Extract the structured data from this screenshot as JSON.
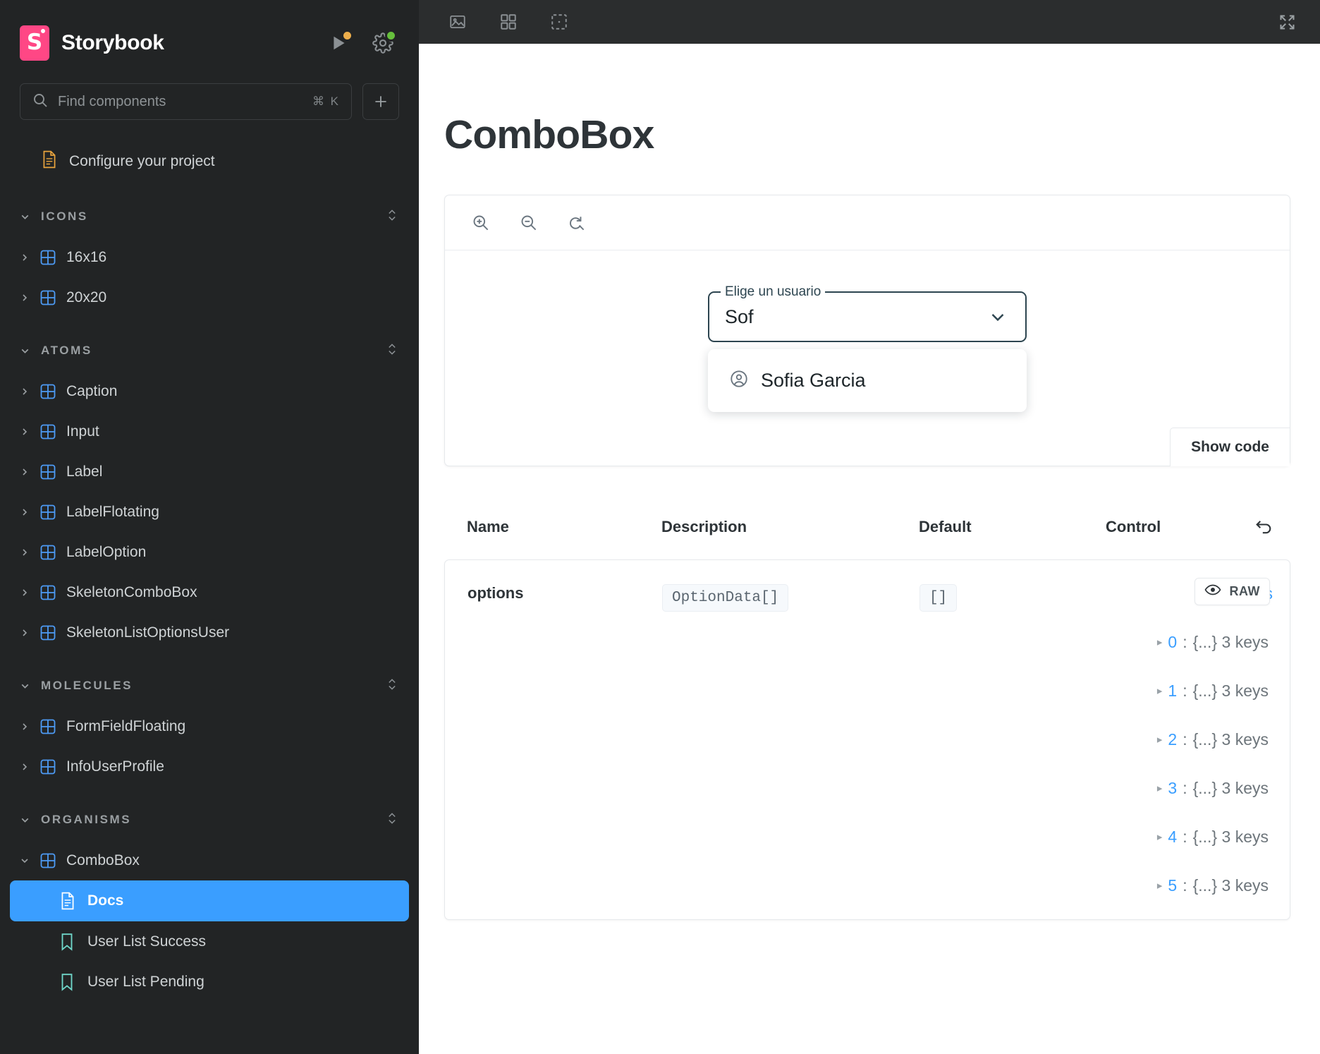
{
  "sidebar": {
    "brand": {
      "name": "Storybook",
      "logo_glyph": "S",
      "logo_color": "#ff4785"
    },
    "header_actions": [
      {
        "name": "play-icon",
        "badge_color": "#edae4b"
      },
      {
        "name": "gear-icon",
        "badge_color": "#66bf3c"
      }
    ],
    "search": {
      "placeholder": "Find components",
      "shortcut": "⌘ K",
      "add_label": "+"
    },
    "configure": {
      "label": "Configure your project"
    },
    "groups": [
      {
        "label": "ICONS",
        "items": [
          {
            "label": "16x16",
            "type": "component",
            "expanded": false
          },
          {
            "label": "20x20",
            "type": "component",
            "expanded": false
          }
        ]
      },
      {
        "label": "ATOMS",
        "items": [
          {
            "label": "Caption",
            "type": "component",
            "expanded": false
          },
          {
            "label": "Input",
            "type": "component",
            "expanded": false
          },
          {
            "label": "Label",
            "type": "component",
            "expanded": false
          },
          {
            "label": "LabelFlotating",
            "type": "component",
            "expanded": false
          },
          {
            "label": "LabelOption",
            "type": "component",
            "expanded": false
          },
          {
            "label": "SkeletonComboBox",
            "type": "component",
            "expanded": false
          },
          {
            "label": "SkeletonListOptionsUser",
            "type": "component",
            "expanded": false
          }
        ]
      },
      {
        "label": "MOLECULES",
        "items": [
          {
            "label": "FormFieldFloating",
            "type": "component",
            "expanded": false
          },
          {
            "label": "InfoUserProfile",
            "type": "component",
            "expanded": false
          }
        ]
      },
      {
        "label": "ORGANISMS",
        "items": [
          {
            "label": "ComboBox",
            "type": "component",
            "expanded": true
          },
          {
            "label": "Docs",
            "type": "docs",
            "selected": true
          },
          {
            "label": "User List Success",
            "type": "story",
            "selected": false
          },
          {
            "label": "User List Pending",
            "type": "story",
            "selected": false
          }
        ]
      }
    ],
    "selected_color": "#3a9eff"
  },
  "toolbar": {
    "buttons": [
      {
        "name": "image-snapshot-icon"
      },
      {
        "name": "grid-background-icon"
      },
      {
        "name": "measure-outline-icon"
      }
    ],
    "expand_button": {
      "name": "fullscreen-icon"
    }
  },
  "docs": {
    "title": "ComboBox",
    "preview": {
      "toolbar_buttons": [
        {
          "name": "zoom-in-icon"
        },
        {
          "name": "zoom-out-icon"
        },
        {
          "name": "zoom-reset-icon"
        }
      ],
      "show_code_label": "Show code",
      "combobox": {
        "floating_label": "Elige un usuario",
        "value": "Sof",
        "placeholder": "Elige un usuario",
        "border_color": "#2d4550",
        "options": [
          {
            "label": "Sofia Garcia",
            "icon": "user-circle-icon"
          }
        ]
      }
    },
    "args_table": {
      "columns": [
        "Name",
        "Description",
        "Default",
        "Control"
      ],
      "reset_label": "Reset controls",
      "rows": [
        {
          "name": "options",
          "description": "OptionData[]",
          "default": "[]",
          "control": {
            "root_key": "options",
            "raw_label": "RAW",
            "eye_icon": "eye-icon",
            "items": [
              {
                "index": "0",
                "sep": ":",
                "value": "{...} 3 keys"
              },
              {
                "index": "1",
                "sep": ":",
                "value": "{...} 3 keys"
              },
              {
                "index": "2",
                "sep": ":",
                "value": "{...} 3 keys"
              },
              {
                "index": "3",
                "sep": ":",
                "value": "{...} 3 keys"
              },
              {
                "index": "4",
                "sep": ":",
                "value": "{...} 3 keys"
              },
              {
                "index": "5",
                "sep": ":",
                "value": "{...} 3 keys"
              }
            ]
          }
        }
      ]
    }
  }
}
